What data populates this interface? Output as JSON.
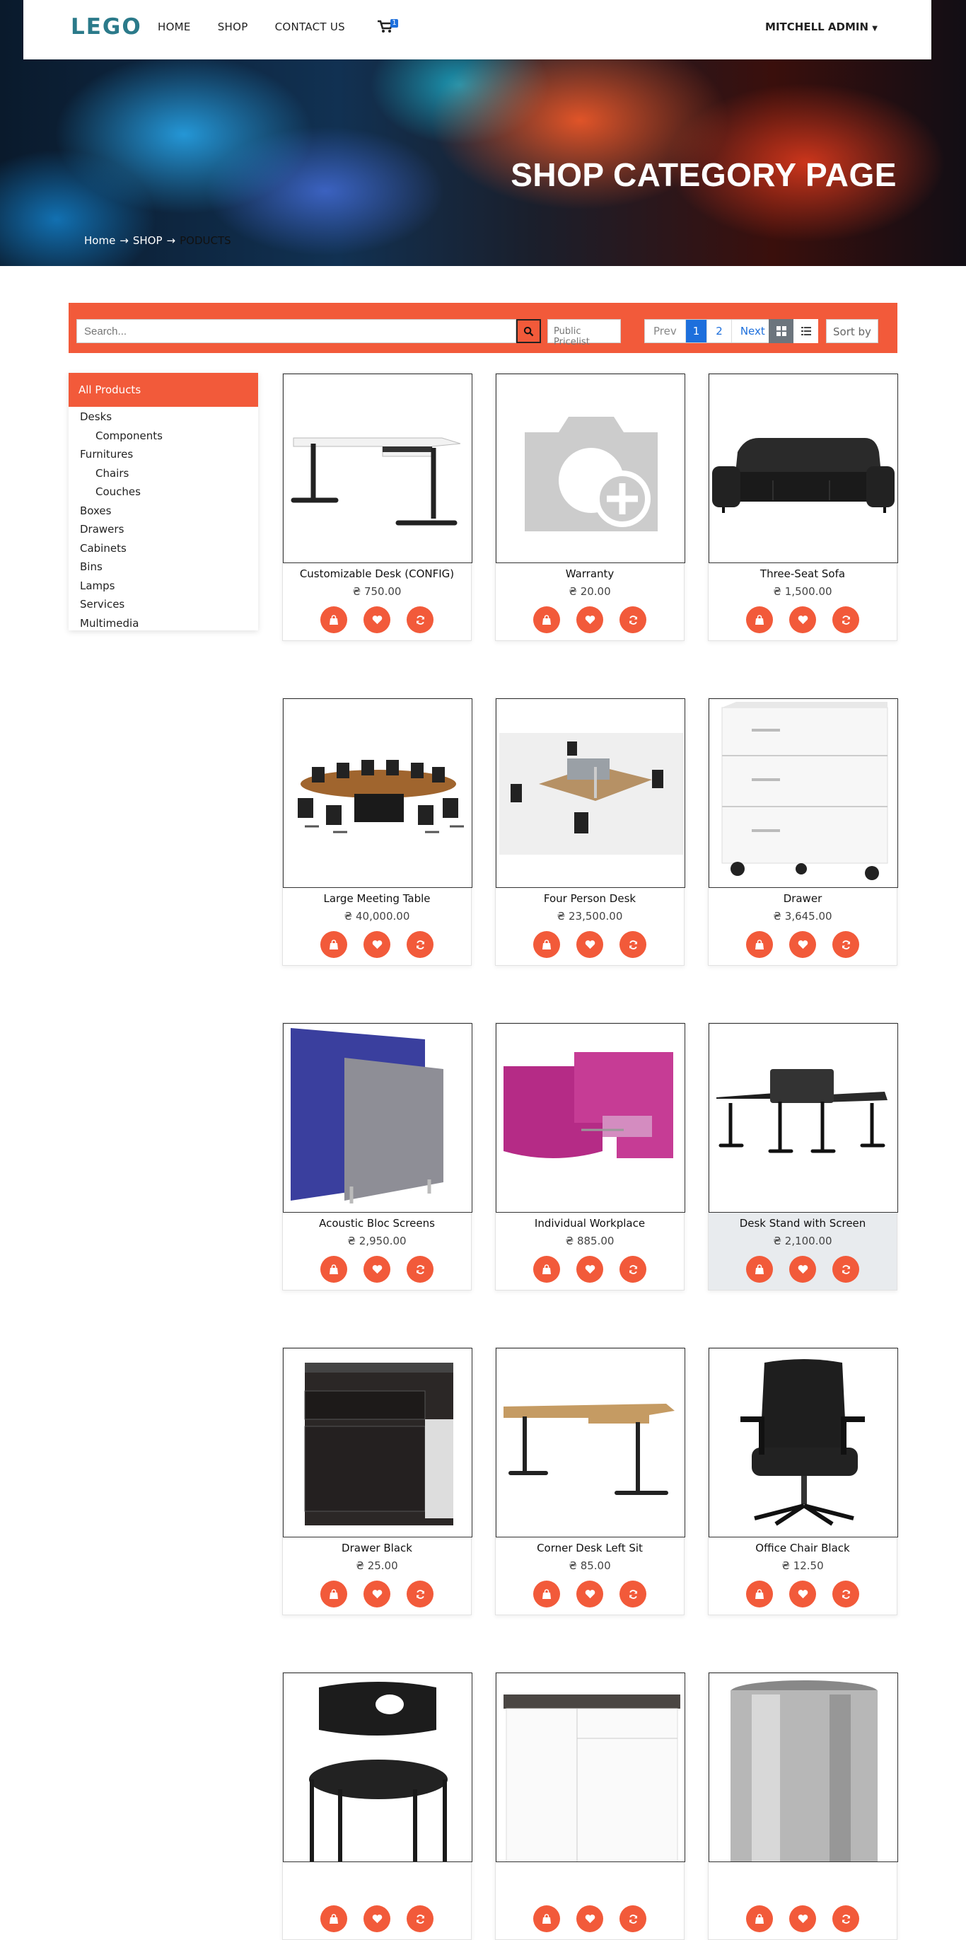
{
  "header": {
    "logo": "LEGO",
    "nav": [
      "HOME",
      "SHOP",
      "CONTACT US"
    ],
    "cart_count": "1",
    "user": "MITCHELL ADMIN"
  },
  "hero": {
    "title": "SHOP CATEGORY PAGE",
    "breadcrumb": [
      "Home",
      "SHOP",
      "PODUCTS"
    ]
  },
  "toolbar": {
    "search_placeholder": "Search...",
    "pricelist": "Public Pricelist",
    "pager": {
      "prev": "Prev",
      "pages": [
        "1",
        "2"
      ],
      "next": "Next"
    },
    "sort": "Sort by"
  },
  "sidebar": {
    "title": "All Products",
    "items": [
      {
        "label": "Desks",
        "sub": false
      },
      {
        "label": "Components",
        "sub": true
      },
      {
        "label": "Furnitures",
        "sub": false
      },
      {
        "label": "Chairs",
        "sub": true
      },
      {
        "label": "Couches",
        "sub": true
      },
      {
        "label": "Boxes",
        "sub": false
      },
      {
        "label": "Drawers",
        "sub": false
      },
      {
        "label": "Cabinets",
        "sub": false
      },
      {
        "label": "Bins",
        "sub": false
      },
      {
        "label": "Lamps",
        "sub": false
      },
      {
        "label": "Services",
        "sub": false
      },
      {
        "label": "Multimedia",
        "sub": false
      }
    ]
  },
  "products": [
    {
      "name": "Customizable Desk (CONFIG)",
      "price": "₴ 750.00",
      "img": "desk"
    },
    {
      "name": "Warranty",
      "price": "₴ 20.00",
      "img": "camera"
    },
    {
      "name": "Three-Seat Sofa",
      "price": "₴ 1,500.00",
      "img": "sofa"
    },
    {
      "name": "Large Meeting Table",
      "price": "₴ 40,000.00",
      "img": "meeting"
    },
    {
      "name": "Four Person Desk",
      "price": "₴ 23,500.00",
      "img": "fourdesk"
    },
    {
      "name": "Drawer",
      "price": "₴ 3,645.00",
      "img": "drawer"
    },
    {
      "name": "Acoustic Bloc Screens",
      "price": "₴ 2,950.00",
      "img": "screens"
    },
    {
      "name": "Individual Workplace",
      "price": "₴ 885.00",
      "img": "workplace"
    },
    {
      "name": "Desk Stand with Screen",
      "price": "₴ 2,100.00",
      "img": "standdesk"
    },
    {
      "name": "Drawer Black",
      "price": "₴ 25.00",
      "img": "drawerblack"
    },
    {
      "name": "Corner Desk Left Sit",
      "price": "₴ 85.00",
      "img": "cornerdesk"
    },
    {
      "name": "Office Chair Black",
      "price": "₴ 12.50",
      "img": "officechair"
    },
    {
      "name": "",
      "price": "",
      "img": "chair"
    },
    {
      "name": "",
      "price": "",
      "img": "cabinet"
    },
    {
      "name": "",
      "price": "",
      "img": "bin"
    }
  ],
  "colors": {
    "accent": "#f25a3a",
    "link": "#1d6fdc",
    "logo": "#2b7a8a"
  }
}
